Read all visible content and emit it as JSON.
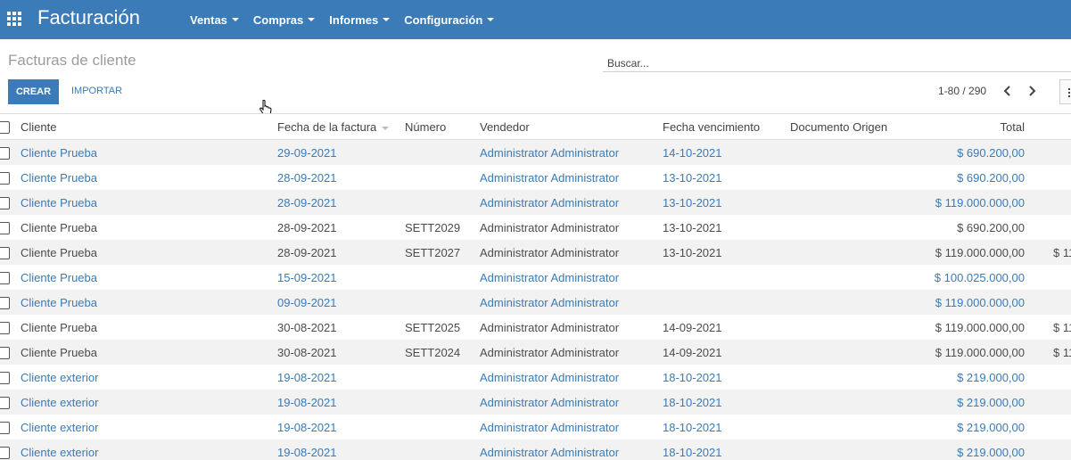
{
  "navbar": {
    "app_title": "Facturación",
    "menu": [
      {
        "label": "Ventas"
      },
      {
        "label": "Compras"
      },
      {
        "label": "Informes"
      },
      {
        "label": "Configuración"
      }
    ]
  },
  "control_panel": {
    "breadcrumb": "Facturas de cliente",
    "search_placeholder": "Buscar...",
    "create_label": "CREAR",
    "import_label": "IMPORTAR",
    "pager": "1-80 / 290"
  },
  "table": {
    "headers": {
      "client": "Cliente",
      "date": "Fecha de la factura",
      "number": "Número",
      "vendor": "Vendedor",
      "due": "Fecha vencimiento",
      "origin": "Documento Origen",
      "total": "Total"
    },
    "rows": [
      {
        "client": "Cliente Prueba",
        "date": "29-09-2021",
        "number": "",
        "vendor": "Administrator Administrator",
        "due": "14-10-2021",
        "origin": "",
        "total": "$ 690.200,00",
        "extra": "",
        "draft": true
      },
      {
        "client": "Cliente Prueba",
        "date": "28-09-2021",
        "number": "",
        "vendor": "Administrator Administrator",
        "due": "13-10-2021",
        "origin": "",
        "total": "$ 690.200,00",
        "extra": "",
        "draft": true
      },
      {
        "client": "Cliente Prueba",
        "date": "28-09-2021",
        "number": "",
        "vendor": "Administrator Administrator",
        "due": "13-10-2021",
        "origin": "",
        "total": "$ 119.000.000,00",
        "extra": "",
        "draft": true
      },
      {
        "client": "Cliente Prueba",
        "date": "28-09-2021",
        "number": "SETT2029",
        "vendor": "Administrator Administrator",
        "due": "13-10-2021",
        "origin": "",
        "total": "$ 690.200,00",
        "extra": "",
        "draft": false
      },
      {
        "client": "Cliente Prueba",
        "date": "28-09-2021",
        "number": "SETT2027",
        "vendor": "Administrator Administrator",
        "due": "13-10-2021",
        "origin": "",
        "total": "$ 119.000.000,00",
        "extra": "$ 11",
        "draft": false
      },
      {
        "client": "Cliente Prueba",
        "date": "15-09-2021",
        "number": "",
        "vendor": "Administrator Administrator",
        "due": "",
        "origin": "",
        "total": "$ 100.025.000,00",
        "extra": "",
        "draft": true
      },
      {
        "client": "Cliente Prueba",
        "date": "09-09-2021",
        "number": "",
        "vendor": "Administrator Administrator",
        "due": "",
        "origin": "",
        "total": "$ 119.000.000,00",
        "extra": "",
        "draft": true
      },
      {
        "client": "Cliente Prueba",
        "date": "30-08-2021",
        "number": "SETT2025",
        "vendor": "Administrator Administrator",
        "due": "14-09-2021",
        "origin": "",
        "total": "$ 119.000.000,00",
        "extra": "$ 11",
        "draft": false
      },
      {
        "client": "Cliente Prueba",
        "date": "30-08-2021",
        "number": "SETT2024",
        "vendor": "Administrator Administrator",
        "due": "14-09-2021",
        "origin": "",
        "total": "$ 119.000.000,00",
        "extra": "$ 11",
        "draft": false
      },
      {
        "client": "Cliente exterior",
        "date": "19-08-2021",
        "number": "",
        "vendor": "Administrator Administrator",
        "due": "18-10-2021",
        "origin": "",
        "total": "$ 219.000,00",
        "extra": "",
        "draft": true
      },
      {
        "client": "Cliente exterior",
        "date": "19-08-2021",
        "number": "",
        "vendor": "Administrator Administrator",
        "due": "18-10-2021",
        "origin": "",
        "total": "$ 219.000,00",
        "extra": "",
        "draft": true
      },
      {
        "client": "Cliente exterior",
        "date": "19-08-2021",
        "number": "",
        "vendor": "Administrator Administrator",
        "due": "18-10-2021",
        "origin": "",
        "total": "$ 219.000,00",
        "extra": "",
        "draft": true
      },
      {
        "client": "Cliente exterior",
        "date": "19-08-2021",
        "number": "",
        "vendor": "Administrator Administrator",
        "due": "18-10-2021",
        "origin": "",
        "total": "$ 219.000,00",
        "extra": "",
        "draft": true
      }
    ]
  },
  "colors": {
    "navbar": "#3a7bb8",
    "link": "#3a7bb8",
    "stripe": "#f2f2f2"
  }
}
